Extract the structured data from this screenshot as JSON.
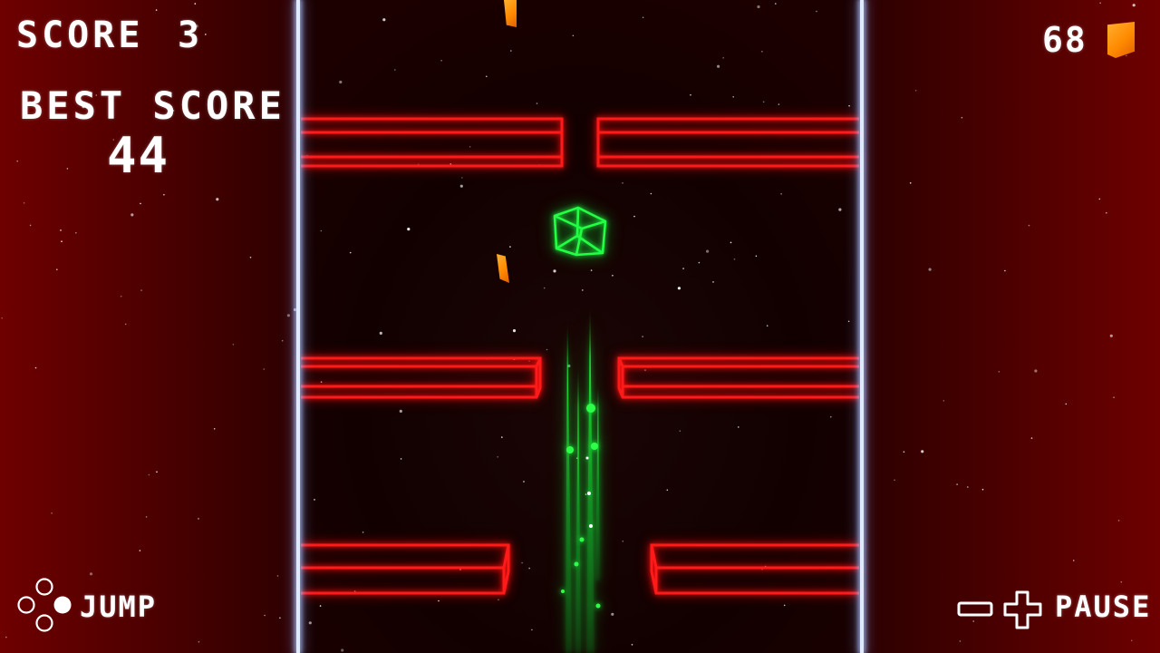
{
  "hud": {
    "score_label": "SCORE",
    "score_value": "3",
    "best_score_label": "BEST SCORE",
    "best_score_value": "44",
    "coin_count": "68",
    "coin_icon": "orange-gem-icon"
  },
  "controls": {
    "jump_label": "JUMP",
    "jump_icon": "face-buttons-icon",
    "pause_label": "PAUSE",
    "pause_icons": [
      "minus-button-icon",
      "plus-button-icon"
    ]
  },
  "colors": {
    "background": "#3a0000",
    "barrier": "#ff1a1a",
    "player": "#22ff44",
    "gem": "#ff8a00",
    "wall": "#dfe9ff",
    "text": "#ffffff"
  }
}
